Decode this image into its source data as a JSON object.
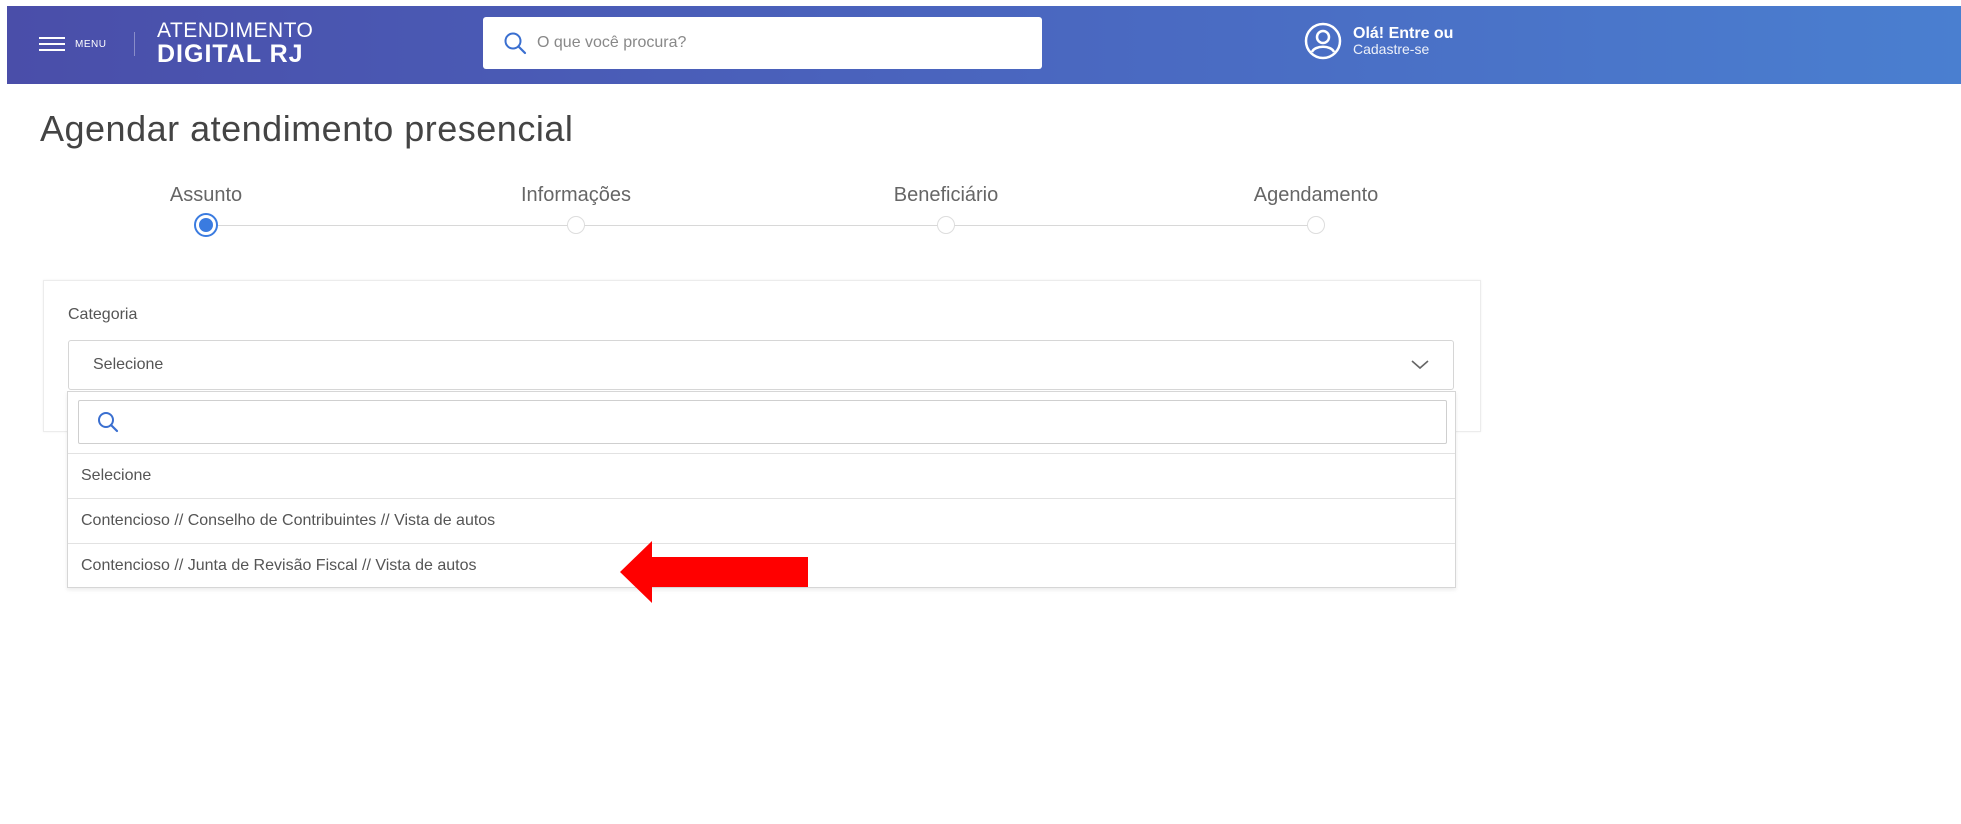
{
  "header": {
    "menu_label": "MENU",
    "brand_line1": "ATENDIMENTO",
    "brand_line2": "DIGITAL RJ",
    "search_placeholder": "O que você procura?",
    "user_greeting": "Olá! Entre ou",
    "user_action": "Cadastre-se"
  },
  "page": {
    "title": "Agendar atendimento presencial"
  },
  "stepper": {
    "steps": [
      {
        "label": "Assunto",
        "active": true
      },
      {
        "label": "Informações",
        "active": false
      },
      {
        "label": "Beneficiário",
        "active": false
      },
      {
        "label": "Agendamento",
        "active": false
      }
    ]
  },
  "form": {
    "category_label": "Categoria",
    "category_value": "Selecione",
    "dropdown": {
      "search_value": "",
      "options": [
        "Selecione",
        "Contencioso // Conselho de Contribuintes // Vista de autos",
        "Contencioso // Junta de Revisão Fiscal // Vista de autos"
      ]
    }
  },
  "colors": {
    "header_start": "#4a4ea9",
    "header_end": "#4a7fd0",
    "accent": "#3a7be0",
    "annotation": "#ff0000"
  },
  "icons": {
    "menu": "hamburger-icon",
    "search": "search-icon",
    "user": "user-circle-icon",
    "dropdown": "chevron-down-icon"
  }
}
